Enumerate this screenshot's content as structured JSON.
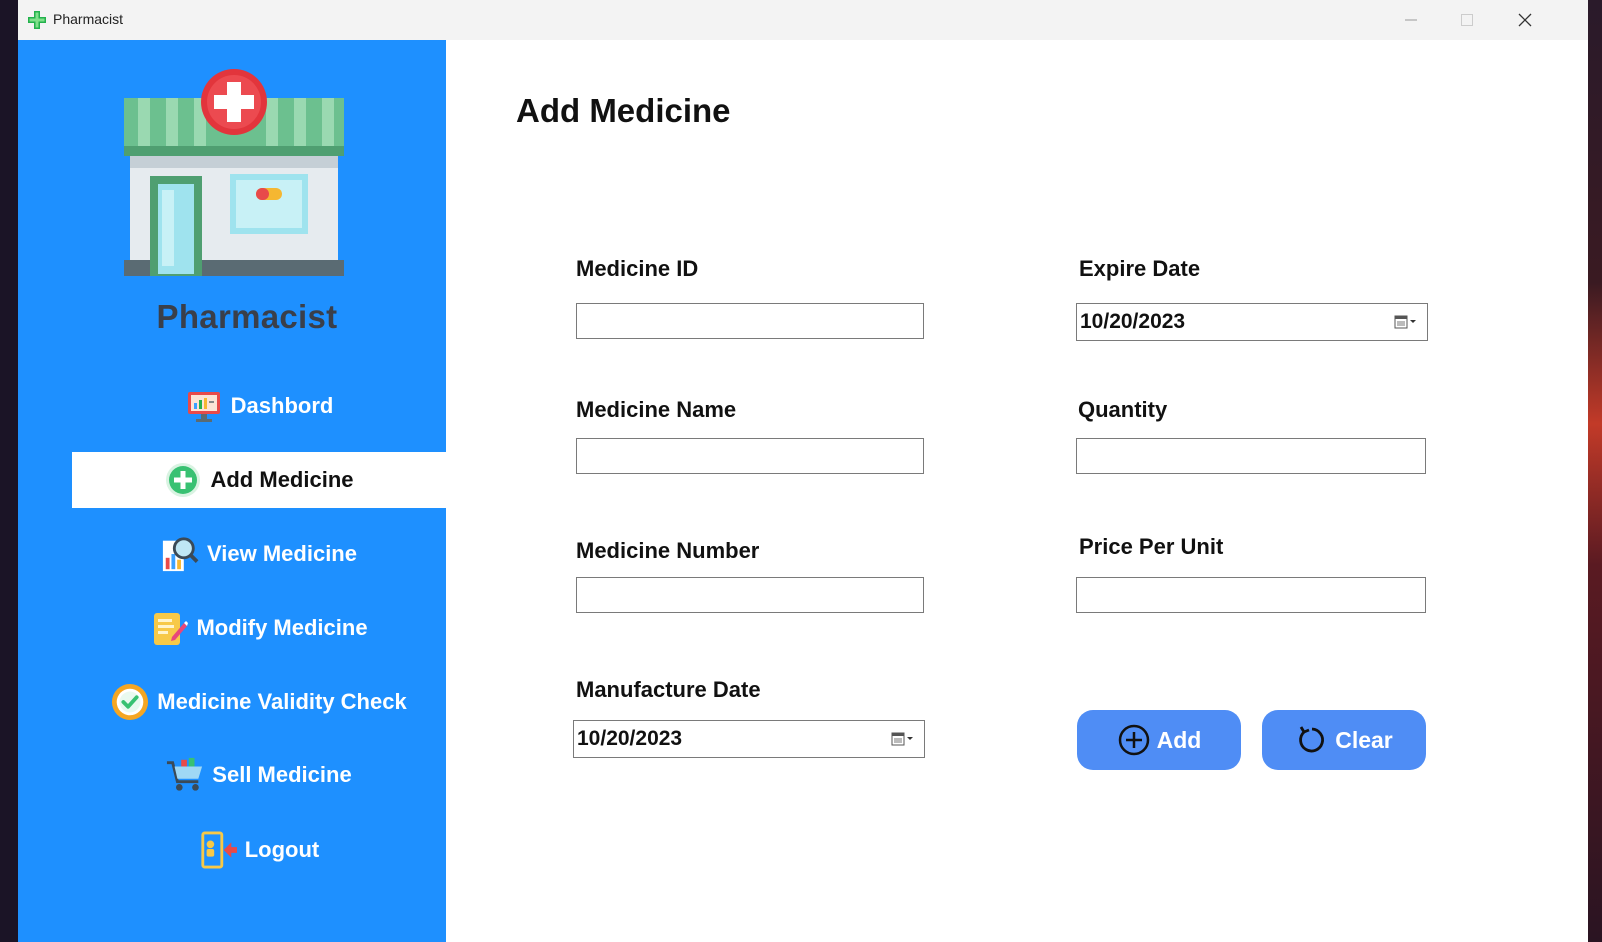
{
  "window": {
    "title": "Pharmacist"
  },
  "sidebar": {
    "brand": "Pharmacist",
    "items": [
      {
        "label": "Dashbord",
        "icon": "dashboard-icon",
        "active": false
      },
      {
        "label": "Add Medicine",
        "icon": "add-circle-icon",
        "active": true
      },
      {
        "label": "View Medicine",
        "icon": "magnifier-chart-icon",
        "active": false
      },
      {
        "label": "Modify Medicine",
        "icon": "edit-note-icon",
        "active": false
      },
      {
        "label": "Medicine Validity Check",
        "icon": "check-badge-icon",
        "active": false
      },
      {
        "label": "Sell Medicine",
        "icon": "shopping-cart-icon",
        "active": false
      },
      {
        "label": "Logout",
        "icon": "logout-icon",
        "active": false
      }
    ]
  },
  "form": {
    "title": "Add Medicine",
    "medicine_id": {
      "label": "Medicine ID",
      "value": ""
    },
    "medicine_name": {
      "label": "Medicine Name",
      "value": ""
    },
    "medicine_number": {
      "label": "Medicine Number",
      "value": ""
    },
    "manufacture_date": {
      "label": "Manufacture Date",
      "value": "10/20/2023"
    },
    "expire_date": {
      "label": "Expire Date",
      "value": "10/20/2023"
    },
    "quantity": {
      "label": "Quantity",
      "value": ""
    },
    "price_per_unit": {
      "label": "Price Per Unit",
      "value": ""
    },
    "add_button": "Add",
    "clear_button": "Clear"
  },
  "colors": {
    "sidebar_bg": "#1e90ff",
    "button_bg": "#4f8df5",
    "active_item_bg": "#ffffff"
  }
}
